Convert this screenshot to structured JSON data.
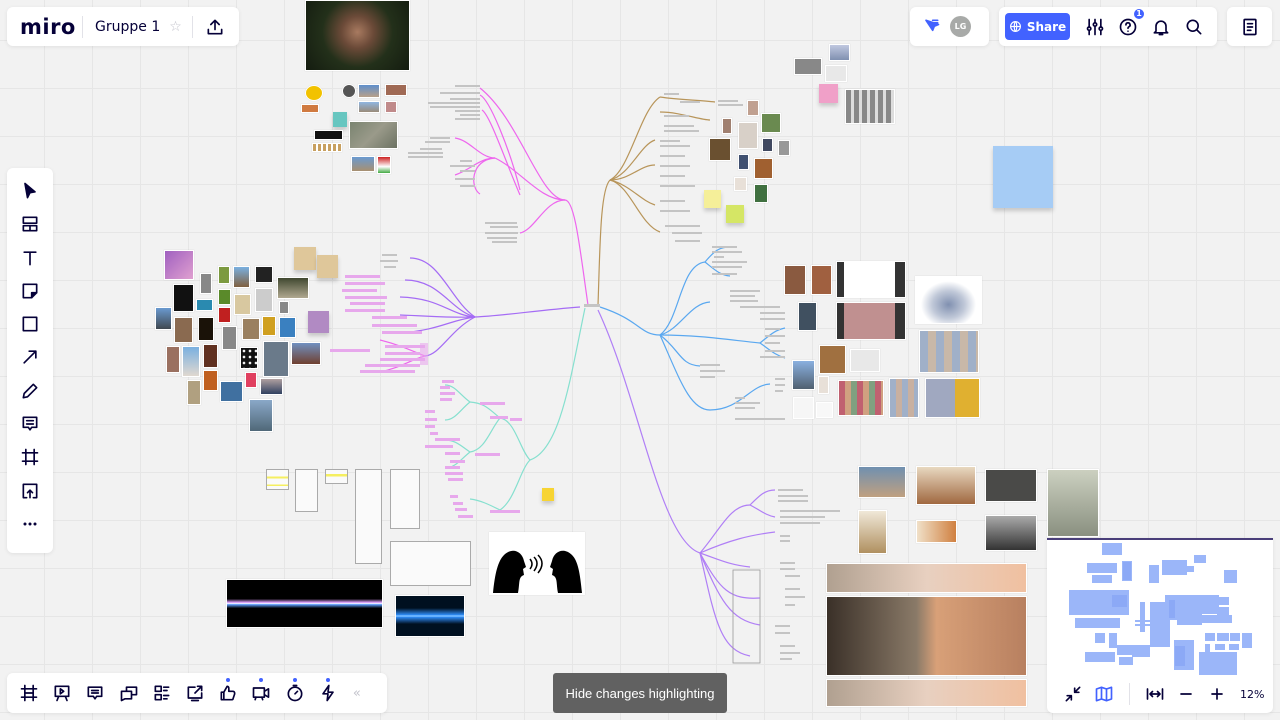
{
  "app": {
    "logo": "miro",
    "board_title": "Gruppe 1"
  },
  "topbar": {
    "collaborator_initials": "LG",
    "share_label": "Share",
    "help_badge_count": "1"
  },
  "left_toolbar": {
    "tools": [
      {
        "name": "select",
        "icon": "cursor-icon"
      },
      {
        "name": "templates",
        "icon": "templates-icon"
      },
      {
        "name": "text",
        "icon": "text-icon"
      },
      {
        "name": "sticky-note",
        "icon": "sticky-note-icon"
      },
      {
        "name": "shape",
        "icon": "rectangle-icon"
      },
      {
        "name": "connection-line",
        "icon": "arrow-icon"
      },
      {
        "name": "pen",
        "icon": "pen-icon"
      },
      {
        "name": "comment",
        "icon": "comment-icon"
      },
      {
        "name": "frame",
        "icon": "frame-icon"
      },
      {
        "name": "upload",
        "icon": "upload-icon"
      },
      {
        "name": "more",
        "icon": "more-icon"
      }
    ]
  },
  "bottom_toolbar": {
    "tools": [
      {
        "name": "frames",
        "icon": "frames-icon",
        "dot": false
      },
      {
        "name": "presentation",
        "icon": "presentation-icon",
        "dot": false
      },
      {
        "name": "comments",
        "icon": "comments-icon",
        "dot": false
      },
      {
        "name": "chat",
        "icon": "chat-icon",
        "dot": false
      },
      {
        "name": "cards",
        "icon": "cards-icon",
        "dot": false
      },
      {
        "name": "screen-share",
        "icon": "screen-share-icon",
        "dot": false
      },
      {
        "name": "voting",
        "icon": "thumbs-up-icon",
        "dot": true
      },
      {
        "name": "video-chat",
        "icon": "video-icon",
        "dot": true
      },
      {
        "name": "timer",
        "icon": "timer-icon",
        "dot": true
      },
      {
        "name": "apps",
        "icon": "lightning-icon",
        "dot": true
      }
    ],
    "collapse_label": "«"
  },
  "hide_highlight_label": "Hide changes highlighting",
  "minimap": {
    "zoom_level": "12%"
  },
  "mindmap": {
    "branch_colors": {
      "pink": "#ee66ee",
      "brown": "#b8955a",
      "blue": "#5aa8f0",
      "violet": "#a56cf5",
      "teal": "#86e0cf",
      "purple": "#b07ff6"
    }
  },
  "accent": "#4262ff"
}
